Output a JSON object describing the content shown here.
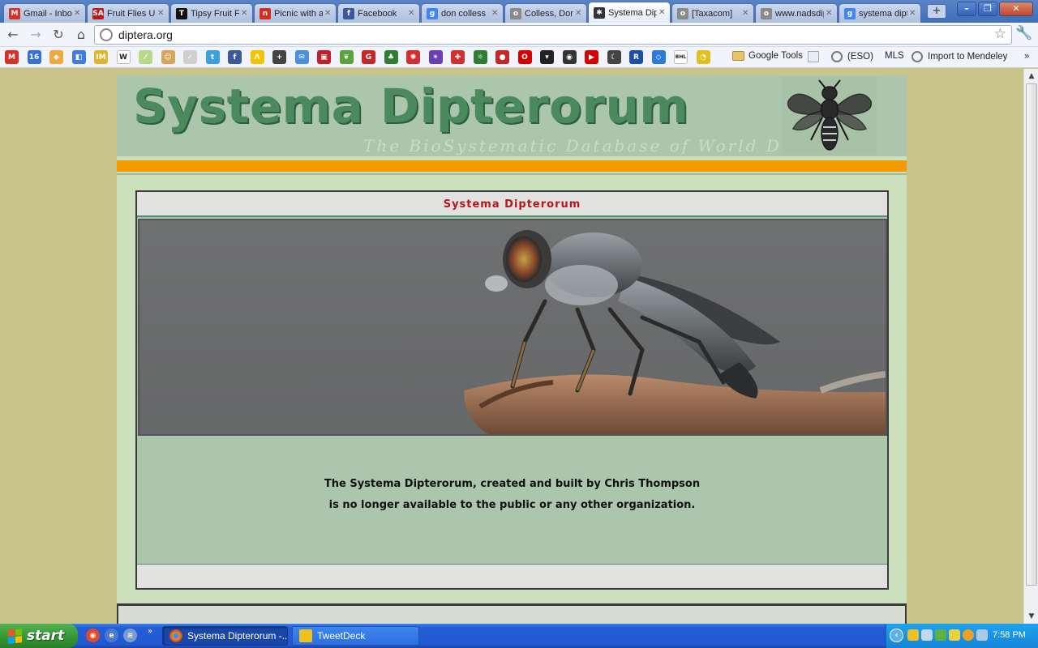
{
  "browser": {
    "tabs": [
      {
        "title": "Gmail - Inbox",
        "favicon": "gmail-icon",
        "color": "#d93025",
        "glyph": "M"
      },
      {
        "title": "Fruit Flies Unlimited",
        "favicon": "sa-icon",
        "color": "#b71c1c",
        "glyph": "SA"
      },
      {
        "title": "Tipsy Fruit Flies",
        "favicon": "nytimes-icon",
        "color": "#111111",
        "glyph": "T"
      },
      {
        "title": "Picnic with a Fly",
        "favicon": "npr-icon",
        "color": "#d62d20",
        "glyph": "n"
      },
      {
        "title": "Facebook",
        "favicon": "facebook-icon",
        "color": "#3b5998",
        "glyph": "f"
      },
      {
        "title": "don colless",
        "favicon": "google-icon",
        "color": "#4285f4",
        "glyph": "g"
      },
      {
        "title": "Colless, Donald",
        "favicon": "globe-icon",
        "color": "#8a8a8a",
        "glyph": "o"
      },
      {
        "title": "Systema Dipterorum",
        "favicon": "fly-icon",
        "color": "#333333",
        "glyph": "✱",
        "active": true
      },
      {
        "title": "[Taxacom]",
        "favicon": "globe-icon",
        "color": "#8a8a8a",
        "glyph": "o"
      },
      {
        "title": "www.nadsdiptera.org",
        "favicon": "globe-icon",
        "color": "#8a8a8a",
        "glyph": "o"
      },
      {
        "title": "systema dipterorum",
        "favicon": "google-icon",
        "color": "#4285f4",
        "glyph": "g"
      }
    ],
    "url": "diptera.org",
    "bookmarks": [
      {
        "name": "gmail-icon",
        "color": "#d93025",
        "glyph": "M"
      },
      {
        "name": "calendar-icon",
        "color": "#3a6fd6",
        "glyph": "16"
      },
      {
        "name": "picasa-icon",
        "color": "#f2a83a",
        "glyph": "◆"
      },
      {
        "name": "google-reader-icon",
        "color": "#3f7de0",
        "glyph": "◧"
      },
      {
        "name": "imdb-icon",
        "color": "#e0b52b",
        "glyph": "IM"
      },
      {
        "name": "wikipedia-icon",
        "color": "#ffffff",
        "glyph": "W"
      },
      {
        "name": "wand-icon",
        "color": "#b8d88a",
        "glyph": "⁄"
      },
      {
        "name": "cookie-icon",
        "color": "#d8a45a",
        "glyph": "☺"
      },
      {
        "name": "document-icon",
        "color": "#cfcfcf",
        "glyph": "✓"
      },
      {
        "name": "twitter-icon",
        "color": "#3aa0e0",
        "glyph": "t"
      },
      {
        "name": "facebook-icon",
        "color": "#3b5998",
        "glyph": "f"
      },
      {
        "name": "triangle-icon",
        "color": "#f5c400",
        "glyph": "Λ"
      },
      {
        "name": "plus-icon",
        "color": "#444444",
        "glyph": "+"
      },
      {
        "name": "mail-check-icon",
        "color": "#4a90d9",
        "glyph": "✉"
      },
      {
        "name": "mcgill-icon",
        "color": "#c0202a",
        "glyph": "▣"
      },
      {
        "name": "leaf-icon",
        "color": "#5aa33a",
        "glyph": "❦"
      },
      {
        "name": "g-red-icon",
        "color": "#c62828",
        "glyph": "G"
      },
      {
        "name": "trees-icon",
        "color": "#2e7d32",
        "glyph": "♣"
      },
      {
        "name": "cbc-icon",
        "color": "#d32f2f",
        "glyph": "✺"
      },
      {
        "name": "nbc-icon",
        "color": "#6a3fb5",
        "glyph": "✶"
      },
      {
        "name": "target-icon",
        "color": "#d32f2f",
        "glyph": "✚"
      },
      {
        "name": "bug-icon",
        "color": "#2e7d32",
        "glyph": "☼"
      },
      {
        "name": "ladybug-icon",
        "color": "#c62828",
        "glyph": "●"
      },
      {
        "name": "opera-icon",
        "color": "#d50000",
        "glyph": "O"
      },
      {
        "name": "bird-icon",
        "color": "#222222",
        "glyph": "▾"
      },
      {
        "name": "camera-icon",
        "color": "#333333",
        "glyph": "◉"
      },
      {
        "name": "youtube-icon",
        "color": "#d50000",
        "glyph": "▶"
      },
      {
        "name": "moon-icon",
        "color": "#444444",
        "glyph": "☾"
      },
      {
        "name": "rbc-icon",
        "color": "#1c4fa8",
        "glyph": "R"
      },
      {
        "name": "dropbox-icon",
        "color": "#2a7bd6",
        "glyph": "◇"
      },
      {
        "name": "bhl-icon",
        "color": "#ffffff",
        "glyph": "BHL"
      },
      {
        "name": "clock-icon",
        "color": "#e0c020",
        "glyph": "◔"
      }
    ],
    "bookmark_text": {
      "google_tools": "Google Tools",
      "eso": "(ESO)",
      "mls": "MLS",
      "mendeley": "Import to Mendeley",
      "more": "»"
    }
  },
  "site": {
    "title": "Systema Dipterorum",
    "subtitle": "The BioSystematic Database of World Diptera",
    "panel_title": "Systema Dipterorum",
    "notice_line1": "The Systema Dipterorum, created and built by Chris Thompson",
    "notice_line2": "is no longer available to the public or any other organization.",
    "colors": {
      "title_green": "#4a8a5e",
      "orange_bar": "#f39a00",
      "panel_title_red": "#b01a1a",
      "panel_bg": "#acc6ad",
      "page_bg": "#c9c58a"
    }
  },
  "taskbar": {
    "start_label": "start",
    "windows": [
      {
        "title": "Systema Dipterorum -...",
        "icon": "chrome-icon",
        "active": true
      },
      {
        "title": "TweetDeck",
        "icon": "tweetdeck-icon",
        "active": false
      }
    ],
    "clock": "7:58 PM"
  }
}
